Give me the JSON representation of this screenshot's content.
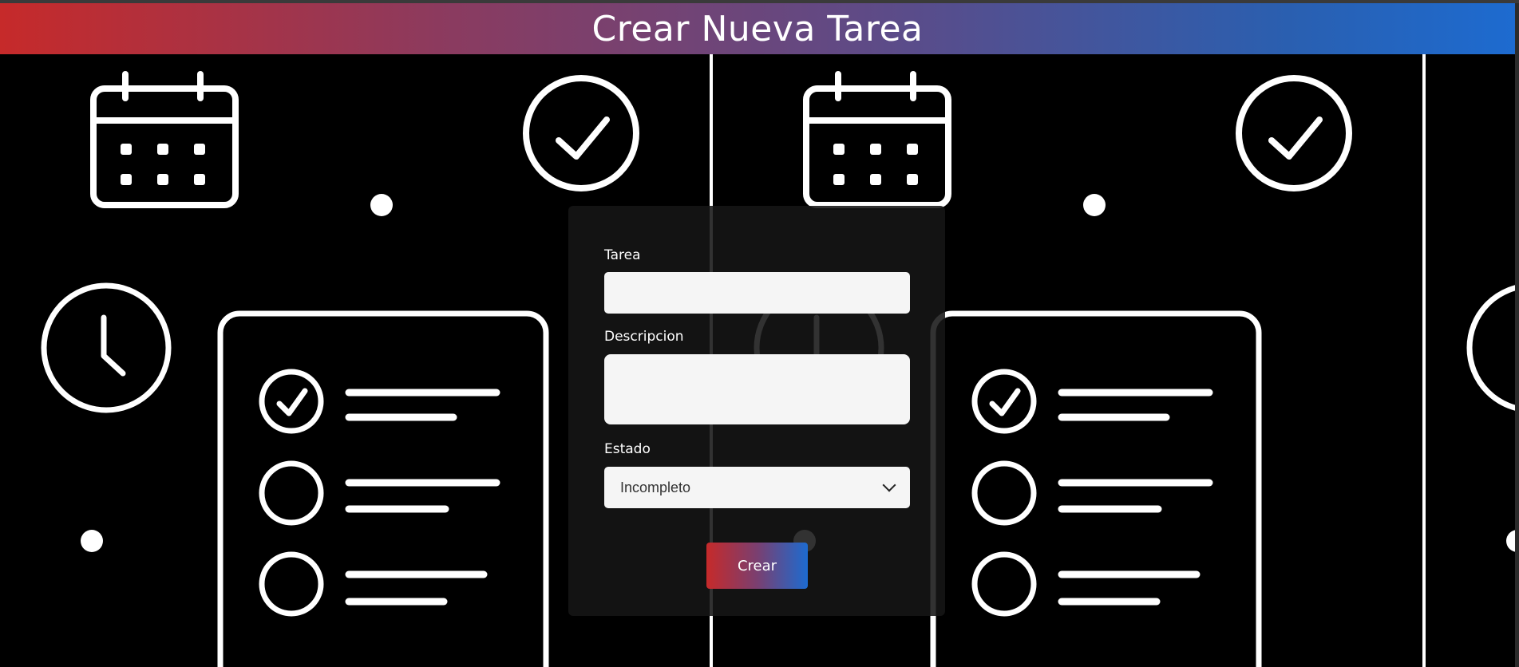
{
  "page": {
    "title": "Crear Nueva Tarea"
  },
  "form": {
    "task_label": "Tarea",
    "task_value": "",
    "description_label": "Descripcion",
    "description_value": "",
    "status_label": "Estado",
    "status_selected": "Incompleto",
    "submit_label": "Crear"
  },
  "colors": {
    "header_start": "#c62a2a",
    "header_end": "#1d6bd0",
    "background": "#000000"
  },
  "background_icons": [
    "calendar-icon",
    "check-circle-icon",
    "clock-icon",
    "checklist-icon"
  ]
}
